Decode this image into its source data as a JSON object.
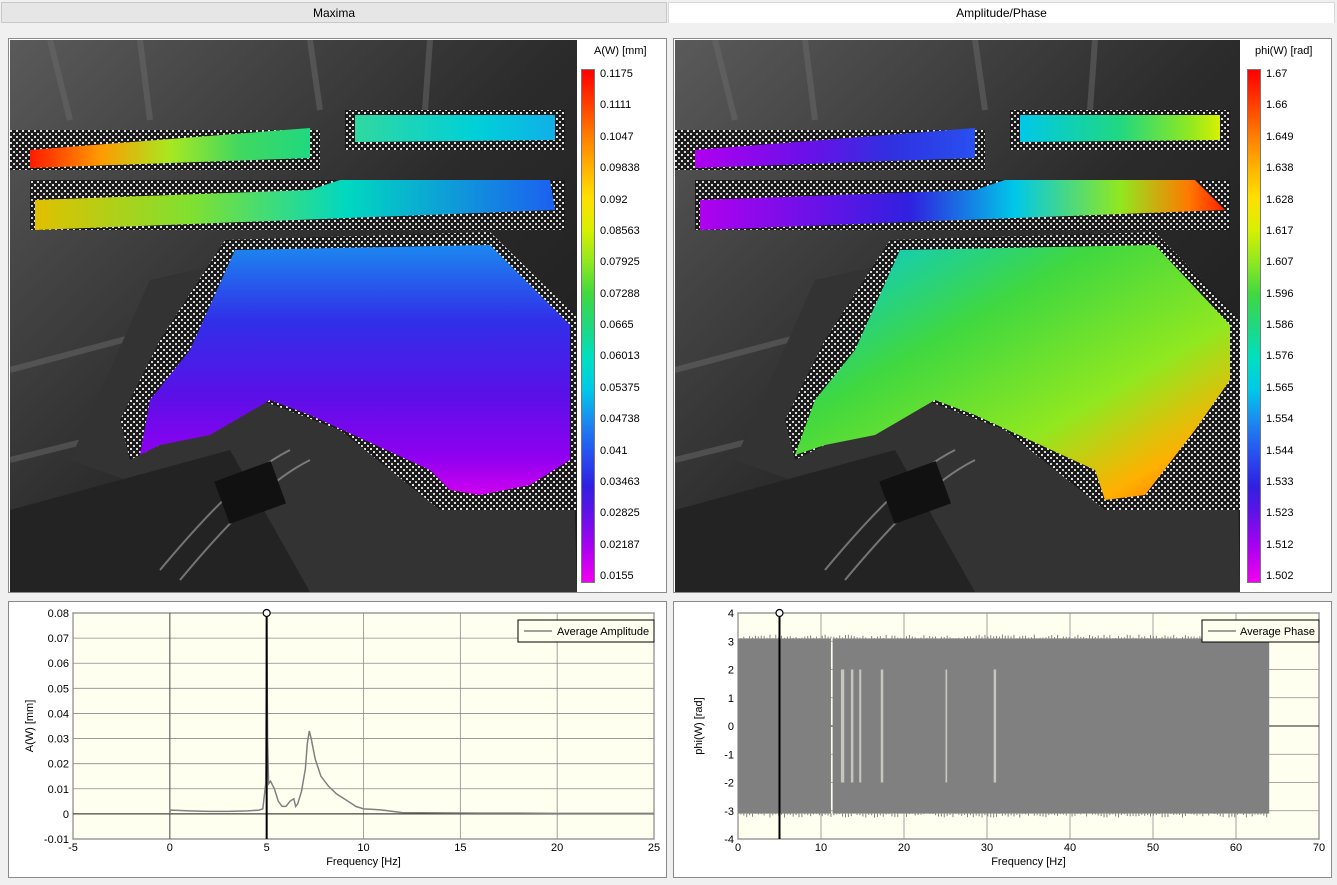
{
  "tabs": {
    "maxima": "Maxima",
    "amplitude_phase": "Amplitude/Phase"
  },
  "amplitude_map": {
    "colorbar_title": "A(W) [mm]",
    "colorbar_labels": [
      "0.1175",
      "0.1111",
      "0.1047",
      "0.09838",
      "0.092",
      "0.08563",
      "0.07925",
      "0.07288",
      "0.0665",
      "0.06013",
      "0.05375",
      "0.04738",
      "0.041",
      "0.03463",
      "0.02825",
      "0.02187",
      "0.0155"
    ],
    "colorbar_colors": [
      "#ff0000",
      "#ff3a00",
      "#ff7a00",
      "#ffb000",
      "#ffe000",
      "#d8f000",
      "#90e820",
      "#40d840",
      "#20d880",
      "#00e0c0",
      "#00c8e8",
      "#1c88f0",
      "#2850f0",
      "#3020e0",
      "#6a10e8",
      "#b000f0",
      "#f000f0"
    ]
  },
  "phase_map": {
    "colorbar_title": "phi(W) [rad]",
    "colorbar_labels": [
      "1.67",
      "1.66",
      "1.649",
      "1.638",
      "1.628",
      "1.617",
      "1.607",
      "1.596",
      "1.586",
      "1.576",
      "1.565",
      "1.554",
      "1.544",
      "1.533",
      "1.523",
      "1.512",
      "1.502"
    ],
    "colorbar_colors": [
      "#ff0000",
      "#ff3a00",
      "#ff7a00",
      "#ffb000",
      "#ffe000",
      "#d8f000",
      "#90e820",
      "#40d840",
      "#20d880",
      "#00e0c0",
      "#00c8e8",
      "#1c88f0",
      "#2850f0",
      "#3020e0",
      "#6a10e8",
      "#b000f0",
      "#f000f0"
    ]
  },
  "chart_data": [
    {
      "type": "line",
      "xlabel": "Frequency [Hz]",
      "ylabel": "A(W) [mm]",
      "xlim": [
        -5,
        25
      ],
      "ylim": [
        -0.01,
        0.08
      ],
      "xticks": [
        "-5",
        "0",
        "5",
        "10",
        "15",
        "20",
        "25"
      ],
      "yticks": [
        "-0.01",
        "0",
        "0.01",
        "0.02",
        "0.03",
        "0.04",
        "0.05",
        "0.06",
        "0.07",
        "0.08"
      ],
      "grid": true,
      "legend_position": "top-right",
      "cursor_x": 5,
      "series": [
        {
          "name": "Average Amplitude",
          "color": "#808080",
          "x": [
            0,
            0.02,
            0.1,
            1,
            2,
            3,
            4,
            4.6,
            4.8,
            4.95,
            5.0,
            5.05,
            5.1,
            5.2,
            5.4,
            5.6,
            5.8,
            6.0,
            6.2,
            6.4,
            6.5,
            6.6,
            6.8,
            7.0,
            7.1,
            7.2,
            7.3,
            7.5,
            7.8,
            8.2,
            8.6,
            9.0,
            9.4,
            9.6,
            10.0,
            10.5,
            11.0,
            11.5,
            12.0,
            14,
            16,
            18,
            20,
            22,
            24,
            25
          ],
          "y": [
            0,
            0.0015,
            0.0015,
            0.0012,
            0.001,
            0.001,
            0.0012,
            0.0015,
            0.002,
            0.012,
            0.08,
            0.03,
            0.012,
            0.013,
            0.01,
            0.005,
            0.003,
            0.003,
            0.005,
            0.006,
            0.003,
            0.004,
            0.009,
            0.018,
            0.028,
            0.033,
            0.03,
            0.022,
            0.015,
            0.011,
            0.008,
            0.006,
            0.004,
            0.003,
            0.002,
            0.0018,
            0.0015,
            0.001,
            0.0005,
            0.0004,
            0.0003,
            0.0003,
            0.0002,
            0.0002,
            0.0002,
            0.0002
          ]
        }
      ]
    },
    {
      "type": "line",
      "xlabel": "Frequency [Hz]",
      "ylabel": "phi(W) [rad]",
      "xlim": [
        0,
        70
      ],
      "ylim": [
        -4,
        4
      ],
      "xticks": [
        "0",
        "10",
        "20",
        "30",
        "40",
        "50",
        "60",
        "70"
      ],
      "yticks": [
        "-4",
        "-3",
        "-2",
        "-1",
        "0",
        "1",
        "2",
        "3",
        "4"
      ],
      "grid": true,
      "legend_position": "top-right",
      "cursor_x": 5,
      "series": [
        {
          "name": "Average Phase",
          "color": "#808080",
          "x_range": [
            0,
            64
          ],
          "band_top": 3.1,
          "band_bottom": -3.1,
          "gap_x_range": [
            11.2,
            11.4
          ]
        }
      ]
    }
  ]
}
